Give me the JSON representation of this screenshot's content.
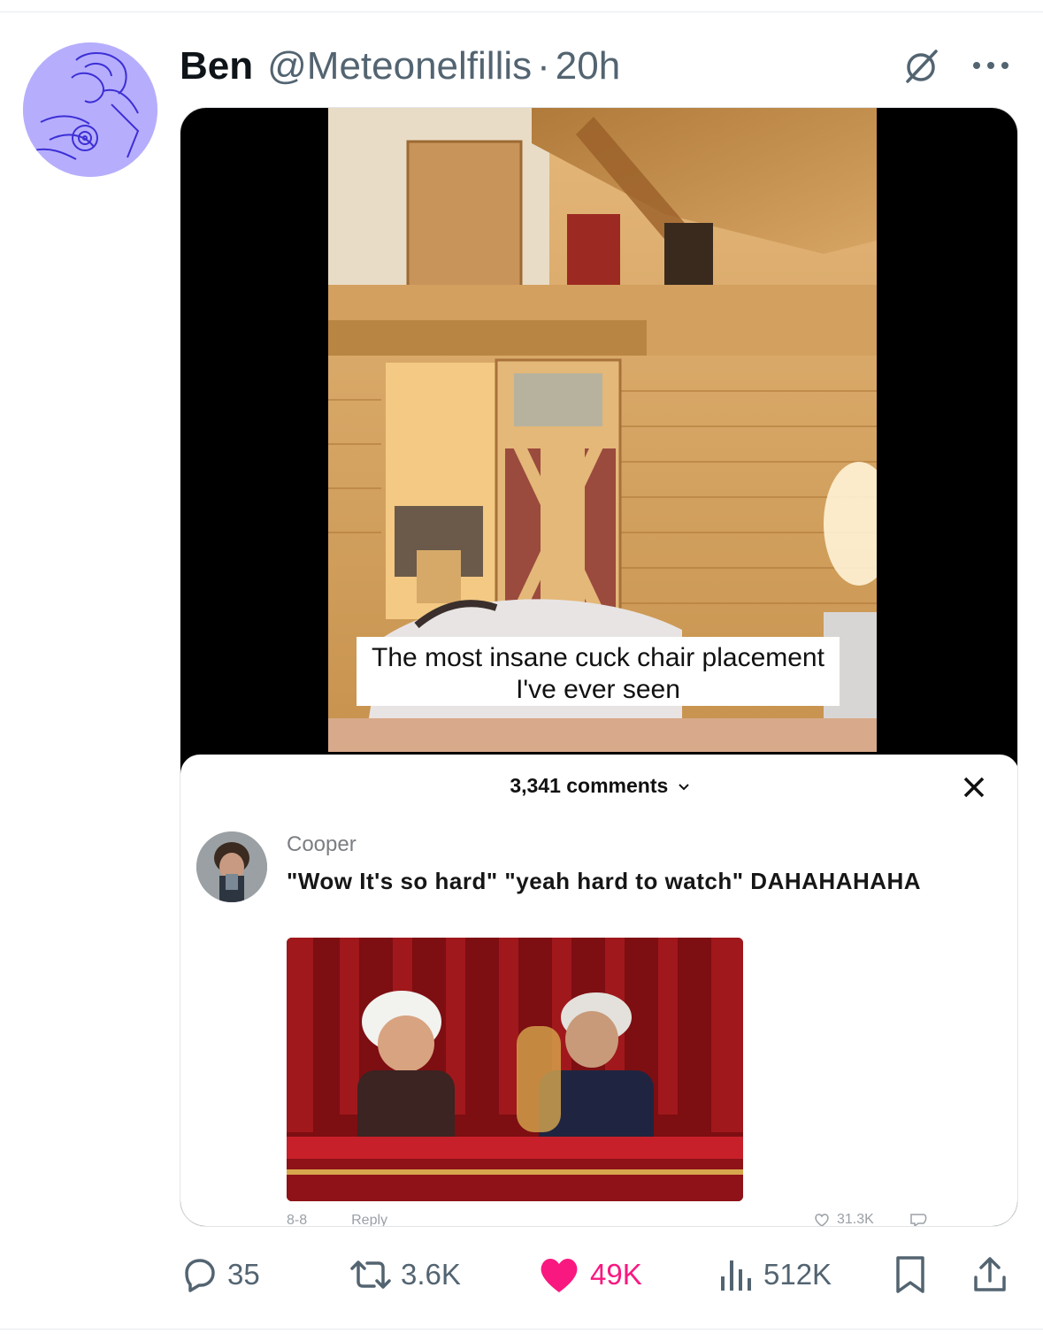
{
  "tweet": {
    "author_name": "Ben",
    "handle": "@Meteonelfillis",
    "separator": "·",
    "time": "20h",
    "icons": {
      "grok": "slashed-circle-icon",
      "more": "more-icon"
    }
  },
  "video": {
    "caption": "The most insane cuck chair placement I've ever seen"
  },
  "comments_sheet": {
    "count_label": "3,341 comments",
    "chevron": "chevron-down-icon",
    "close": "close-icon",
    "comment": {
      "author": "Cooper",
      "text": "\"Wow It's so hard\" \"yeah hard to watch\" DAHAHAHAHA",
      "date": "8-8",
      "reply_label": "Reply",
      "likes": "31.3K"
    }
  },
  "actions": {
    "replies": "35",
    "reposts": "3.6K",
    "likes": "49K",
    "views": "512K",
    "colors": {
      "muted": "#536471",
      "liked": "#f91880"
    }
  }
}
